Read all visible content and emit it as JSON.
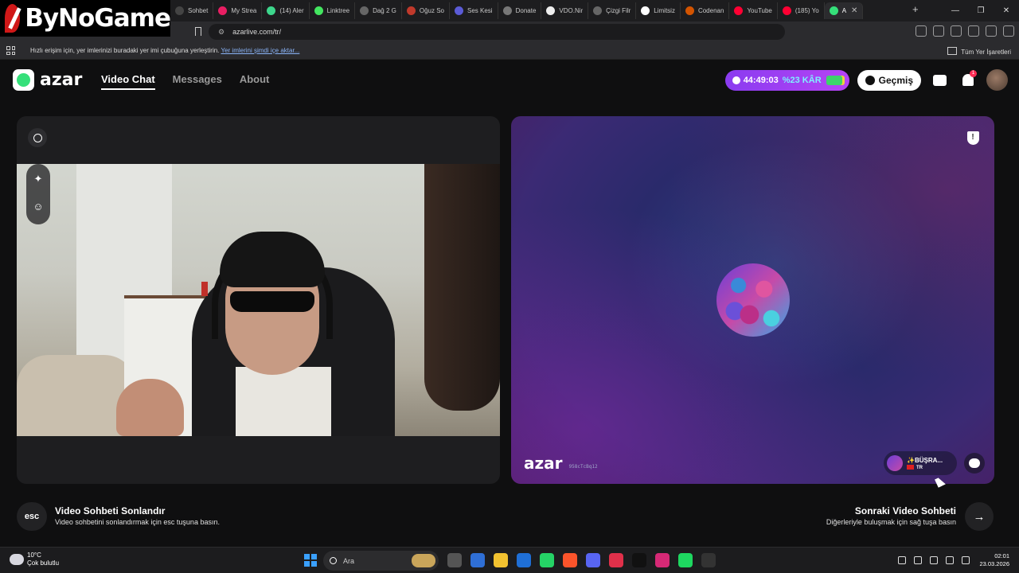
{
  "overlay_logo": "ByNoGame",
  "browser": {
    "tabs": [
      {
        "label": "Sohbet",
        "icon": "chat-tab-icon",
        "color": "#444"
      },
      {
        "label": "My Strea",
        "icon": "stream-tab-icon",
        "color": "#e91e63"
      },
      {
        "label": "(14) Aler",
        "icon": "alerts-tab-icon",
        "color": "#3dd68c"
      },
      {
        "label": "Linktree",
        "icon": "linktree-tab-icon",
        "color": "#43e660"
      },
      {
        "label": "Dağ 2 G",
        "icon": "game-tab-icon",
        "color": "#666"
      },
      {
        "label": "Oğuz So",
        "icon": "oguz-tab-icon",
        "color": "#c0392b"
      },
      {
        "label": "Ses Kesi",
        "icon": "audio-tab-icon",
        "color": "#5b5bd6"
      },
      {
        "label": "Donate",
        "icon": "donate-tab-icon",
        "color": "#777"
      },
      {
        "label": "VDO.Nir",
        "icon": "vdo-tab-icon",
        "color": "#eee"
      },
      {
        "label": "Çizgi Filr",
        "icon": "cartoon-tab-icon",
        "color": "#666"
      },
      {
        "label": "Limitsiz",
        "icon": "limitless-tab-icon",
        "color": "#fff"
      },
      {
        "label": "Codenan",
        "icon": "codenames-tab-icon",
        "color": "#d35400"
      },
      {
        "label": "YouTube",
        "icon": "youtube-tab-icon",
        "color": "#ff0033"
      },
      {
        "label": "(185) Yo",
        "icon": "youtube-tab-icon",
        "color": "#ff0033"
      }
    ],
    "active_tab_label": "A",
    "new_tab": "+",
    "url": "azarlive.com/tr/",
    "bookmarks_hint": "Hızlı erişim için, yer imlerinizi buradaki yer imi çubuğuna yerleştirin.",
    "bookmarks_import_link": "Yer imlerini şimdi içe aktar...",
    "all_bookmarks": "Tüm Yer İşaretleri",
    "window_controls": [
      "—",
      "❐",
      "✕"
    ]
  },
  "app": {
    "brand": "azar",
    "nav": [
      {
        "label": "Video Chat",
        "active": true
      },
      {
        "label": "Messages",
        "active": false
      },
      {
        "label": "About",
        "active": false
      }
    ],
    "timer": "44:49:03",
    "discount": "%23 KÂR",
    "history_label": "Geçmiş",
    "notification_count": "1",
    "accent_purple": "#9b3ef3",
    "accent_green": "#35e07a"
  },
  "peer": {
    "watermark": "azar",
    "session_id": "958cTcBq12",
    "name": "✨BÜŞRA...",
    "country": "TR"
  },
  "footer": {
    "esc_label": "esc",
    "end_title": "Video Sohbeti Sonlandır",
    "end_sub": "Video sohbetini sonlandırmak için esc tuşuna basın.",
    "next_title": "Sonraki Video Sohbeti",
    "next_sub": "Diğerleriyle buluşmak için sağ tuşa basın",
    "next_arrow": "→"
  },
  "taskbar": {
    "temperature": "10°C",
    "weather": "Çok bulutlu",
    "search_placeholder": "Ara",
    "time": "02:01",
    "date": "23.03.2026",
    "apps": [
      {
        "icon": "file-explorer-icon",
        "color": "#555"
      },
      {
        "icon": "store-icon",
        "color": "#2f6fd6"
      },
      {
        "icon": "folder-icon",
        "color": "#f2c230"
      },
      {
        "icon": "mail-icon",
        "color": "#1f6fd6"
      },
      {
        "icon": "whatsapp-icon",
        "color": "#25d366"
      },
      {
        "icon": "brave-icon",
        "color": "#fb542b"
      },
      {
        "icon": "discord-icon",
        "color": "#5865f2"
      },
      {
        "icon": "app-icon",
        "color": "#e0304a"
      },
      {
        "icon": "tiktok-icon",
        "color": "#111"
      },
      {
        "icon": "instagram-icon",
        "color": "#d62976"
      },
      {
        "icon": "spotify-icon",
        "color": "#1ed760"
      },
      {
        "icon": "obs-icon",
        "color": "#333"
      }
    ]
  }
}
